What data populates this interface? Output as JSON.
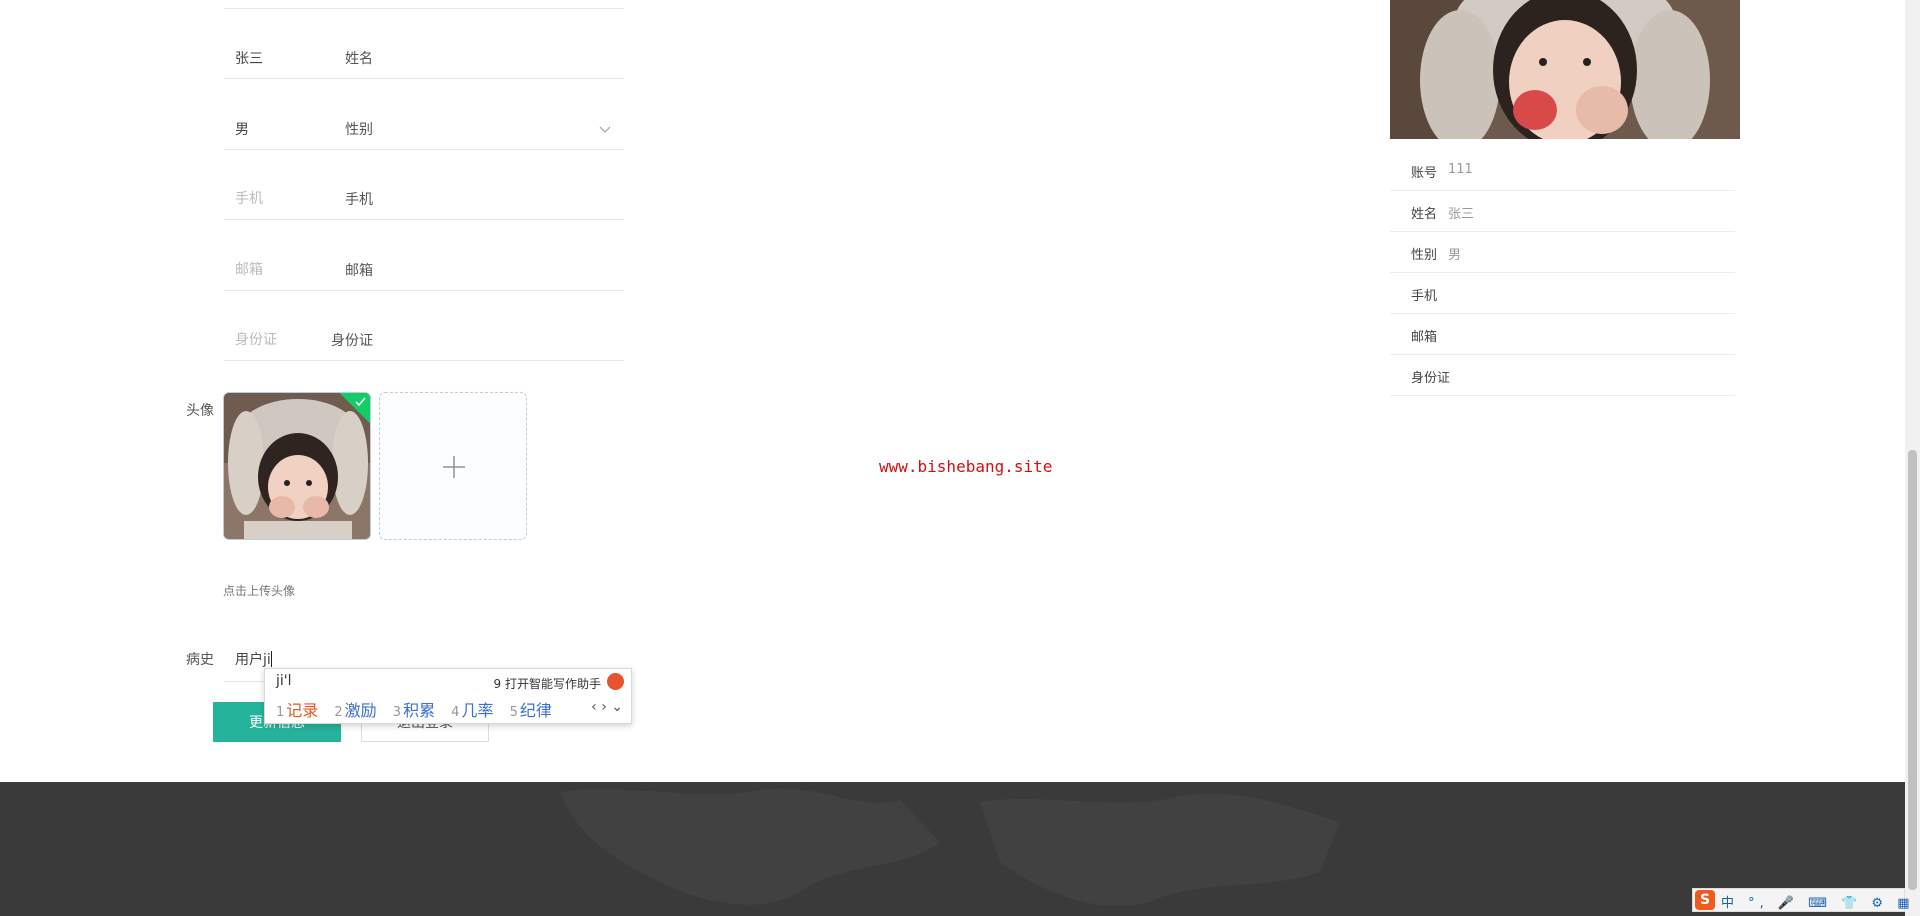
{
  "form": {
    "name": {
      "label": "姓名",
      "value": "张三"
    },
    "gender": {
      "label": "性别",
      "value": "男"
    },
    "phone": {
      "label": "手机",
      "placeholder": "手机",
      "value": ""
    },
    "email": {
      "label": "邮箱",
      "placeholder": "邮箱",
      "value": ""
    },
    "id_card": {
      "label": "身份证",
      "placeholder": "身份证",
      "value": ""
    },
    "avatar": {
      "label": "头像",
      "tip": "点击上传头像"
    },
    "history": {
      "label": "病史",
      "value": "用户ji"
    },
    "buttons": {
      "update": "更新信息",
      "logout": "退出登录"
    }
  },
  "ime": {
    "composition": "ji'l",
    "assistant": "9 打开智能写作助手",
    "candidates": [
      {
        "num": "1",
        "word": "记录"
      },
      {
        "num": "2",
        "word": "激励"
      },
      {
        "num": "3",
        "word": "积累"
      },
      {
        "num": "4",
        "word": "几率"
      },
      {
        "num": "5",
        "word": "纪律"
      }
    ],
    "nav": "‹ › ⌄"
  },
  "watermark": "www.bishebang.site",
  "profile": {
    "rows": [
      {
        "key": "账号",
        "value": "111"
      },
      {
        "key": "姓名",
        "value": "张三"
      },
      {
        "key": "性别",
        "value": "男"
      },
      {
        "key": "手机",
        "value": ""
      },
      {
        "key": "邮箱",
        "value": ""
      },
      {
        "key": "身份证",
        "value": ""
      }
    ]
  },
  "tray": {
    "logo": "S",
    "items": "中 °, 🎤 ⌨ 👕 ⚙ ▦ ✿"
  },
  "colors": {
    "primary": "#26b39c",
    "success": "#13ce66",
    "footer": "#3a3a3a",
    "watermark": "#d01010"
  }
}
